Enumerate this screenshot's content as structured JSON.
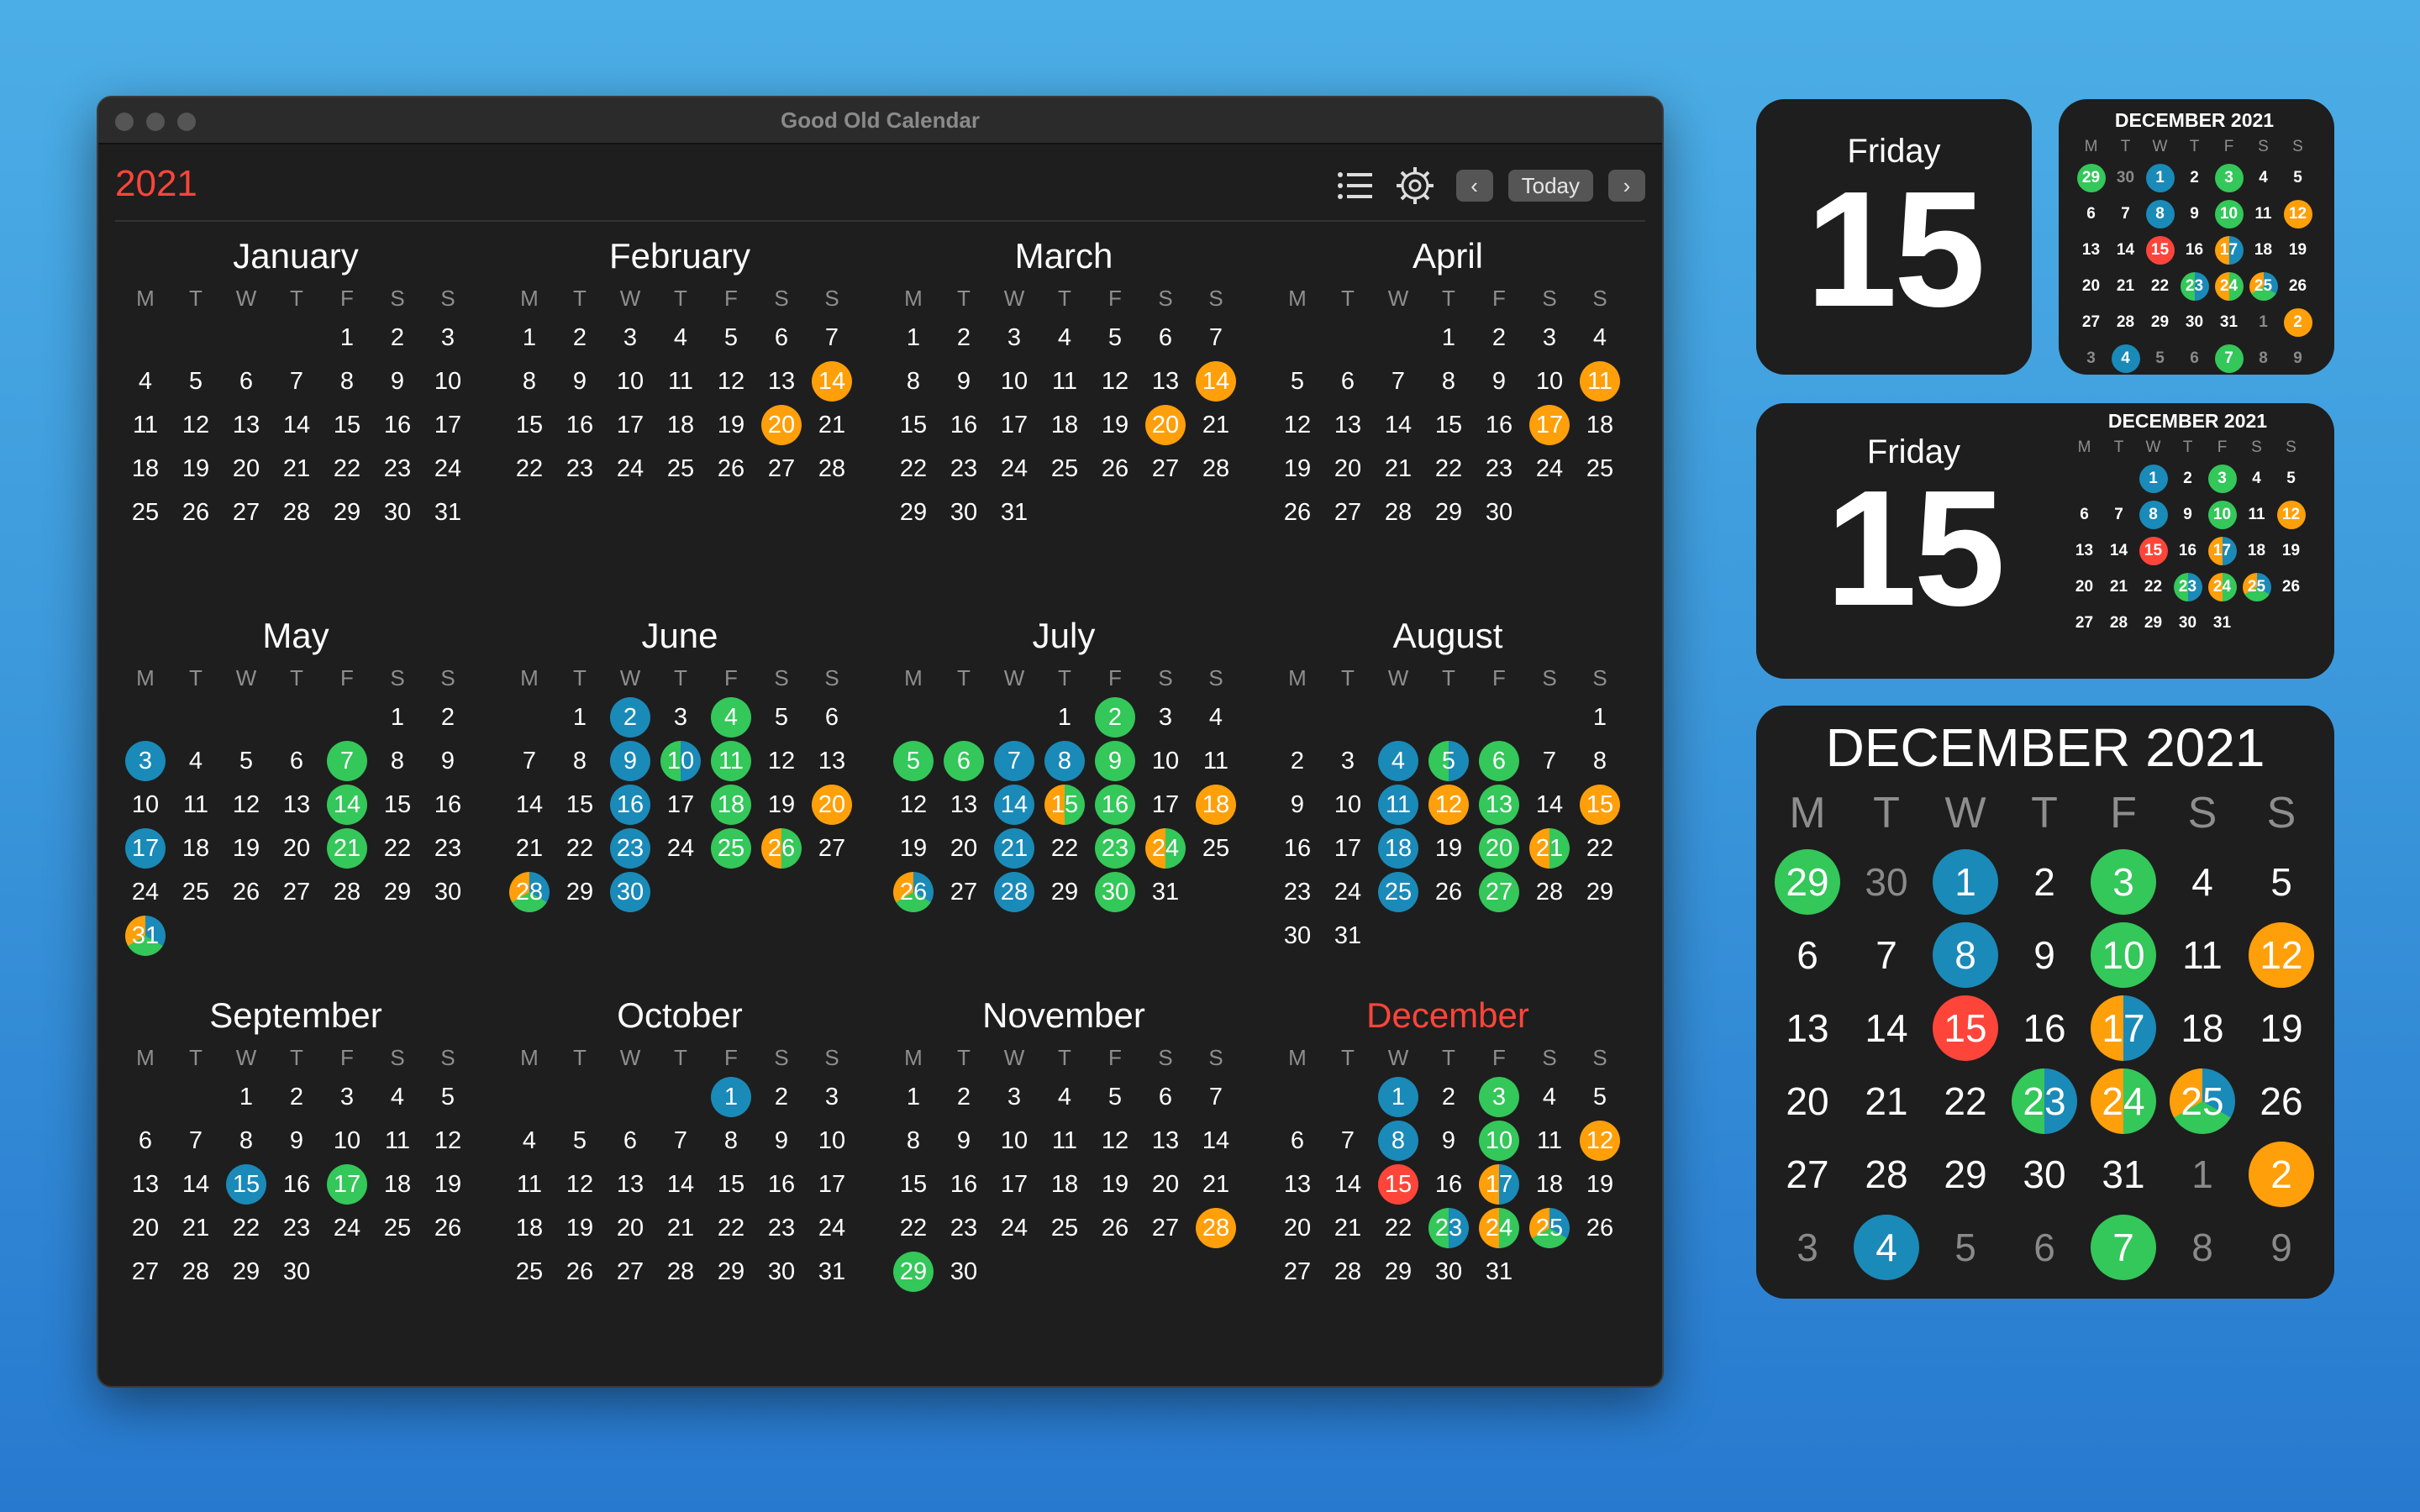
{
  "window": {
    "title": "Good Old Calendar"
  },
  "toolbar": {
    "year": "2021",
    "list_icon": "list-icon",
    "settings_icon": "gear-icon",
    "prev_label": "‹",
    "today_label": "Today",
    "next_label": "›"
  },
  "weekday_initials": [
    "M",
    "T",
    "W",
    "T",
    "F",
    "S",
    "S"
  ],
  "colors": {
    "green": "#34c759",
    "blue": "#1a8ab8",
    "orange": "#ff9f0a",
    "red": "#ff453a",
    "accent": "#ff453a"
  },
  "months": [
    {
      "name": "January",
      "offset": 4,
      "days": 31,
      "marks": {}
    },
    {
      "name": "February",
      "offset": 0,
      "days": 28,
      "marks": {
        "14": "o",
        "20": "o"
      }
    },
    {
      "name": "March",
      "offset": 0,
      "days": 31,
      "marks": {
        "14": "o",
        "20": "o"
      }
    },
    {
      "name": "April",
      "offset": 3,
      "days": 30,
      "marks": {
        "11": "o",
        "17": "o"
      }
    },
    {
      "name": "May",
      "offset": 5,
      "days": 31,
      "marks": {
        "3": "b",
        "7": "g",
        "14": "g",
        "17": "b",
        "21": "g",
        "31": "bgo"
      }
    },
    {
      "name": "June",
      "offset": 1,
      "days": 30,
      "marks": {
        "2": "b",
        "4": "g",
        "9": "b",
        "10": "bg",
        "11": "g",
        "16": "b",
        "18": "g",
        "20": "o",
        "23": "b",
        "25": "g",
        "26": "go",
        "28": "bgo",
        "30": "b"
      }
    },
    {
      "name": "July",
      "offset": 3,
      "days": 31,
      "marks": {
        "2": "g",
        "5": "g",
        "6": "g",
        "7": "b",
        "8": "b",
        "9": "g",
        "14": "b",
        "15": "go",
        "16": "g",
        "18": "o",
        "21": "b",
        "23": "g",
        "24": "go",
        "26": "bgo",
        "28": "b",
        "30": "g"
      }
    },
    {
      "name": "August",
      "offset": 6,
      "days": 31,
      "marks": {
        "4": "b",
        "5": "bg",
        "6": "g",
        "11": "b",
        "12": "o",
        "13": "g",
        "15": "o",
        "18": "b",
        "20": "g",
        "21": "go",
        "25": "b",
        "27": "g"
      }
    },
    {
      "name": "September",
      "offset": 2,
      "days": 30,
      "marks": {
        "15": "b",
        "17": "g"
      }
    },
    {
      "name": "October",
      "offset": 4,
      "days": 31,
      "marks": {
        "1": "b"
      }
    },
    {
      "name": "November",
      "offset": 0,
      "days": 30,
      "marks": {
        "28": "o",
        "29": "g"
      }
    },
    {
      "name": "December",
      "offset": 2,
      "days": 31,
      "current": true,
      "marks": {
        "1": "b",
        "3": "g",
        "8": "b",
        "10": "g",
        "12": "o",
        "15": "r",
        "17": "bo",
        "23": "bg",
        "24": "go",
        "25": "bgo"
      }
    }
  ],
  "widget_small": {
    "weekday": "Friday",
    "day": "15"
  },
  "widget_medium": {
    "weekday": "Friday",
    "day": "15"
  },
  "mini_month": {
    "title": "DECEMBER 2021",
    "weeks": [
      [
        [
          "29",
          "g"
        ],
        [
          "30",
          "d"
        ],
        [
          "1",
          "b"
        ],
        [
          "2",
          ""
        ],
        [
          "3",
          "g"
        ],
        [
          "4",
          ""
        ],
        [
          "5",
          ""
        ]
      ],
      [
        [
          "6",
          ""
        ],
        [
          "7",
          ""
        ],
        [
          "8",
          "b"
        ],
        [
          "9",
          ""
        ],
        [
          "10",
          "g"
        ],
        [
          "11",
          ""
        ],
        [
          "12",
          "o"
        ]
      ],
      [
        [
          "13",
          ""
        ],
        [
          "14",
          ""
        ],
        [
          "15",
          "r"
        ],
        [
          "16",
          ""
        ],
        [
          "17",
          "bo"
        ],
        [
          "18",
          ""
        ],
        [
          "19",
          ""
        ]
      ],
      [
        [
          "20",
          ""
        ],
        [
          "21",
          ""
        ],
        [
          "22",
          ""
        ],
        [
          "23",
          "bg"
        ],
        [
          "24",
          "go"
        ],
        [
          "25",
          "bgo"
        ],
        [
          "26",
          ""
        ]
      ],
      [
        [
          "27",
          ""
        ],
        [
          "28",
          ""
        ],
        [
          "29",
          ""
        ],
        [
          "30",
          ""
        ],
        [
          "31",
          ""
        ],
        [
          "1",
          "d"
        ],
        [
          "2",
          "o"
        ]
      ],
      [
        [
          "3",
          "d"
        ],
        [
          "4",
          "b"
        ],
        [
          "5",
          "d"
        ],
        [
          "6",
          "d"
        ],
        [
          "7",
          "g"
        ],
        [
          "8",
          "d"
        ],
        [
          "9",
          "d"
        ]
      ]
    ],
    "weeks_medium": [
      [
        [
          "",
          ""
        ],
        [
          "",
          ""
        ],
        [
          "1",
          "b"
        ],
        [
          "2",
          ""
        ],
        [
          "3",
          "g"
        ],
        [
          "4",
          ""
        ],
        [
          "5",
          ""
        ]
      ],
      [
        [
          "6",
          ""
        ],
        [
          "7",
          ""
        ],
        [
          "8",
          "b"
        ],
        [
          "9",
          ""
        ],
        [
          "10",
          "g"
        ],
        [
          "11",
          ""
        ],
        [
          "12",
          "o"
        ]
      ],
      [
        [
          "13",
          ""
        ],
        [
          "14",
          ""
        ],
        [
          "15",
          "r"
        ],
        [
          "16",
          ""
        ],
        [
          "17",
          "bo"
        ],
        [
          "18",
          ""
        ],
        [
          "19",
          ""
        ]
      ],
      [
        [
          "20",
          ""
        ],
        [
          "21",
          ""
        ],
        [
          "22",
          ""
        ],
        [
          "23",
          "bg"
        ],
        [
          "24",
          "go"
        ],
        [
          "25",
          "bgo"
        ],
        [
          "26",
          ""
        ]
      ],
      [
        [
          "27",
          ""
        ],
        [
          "28",
          ""
        ],
        [
          "29",
          ""
        ],
        [
          "30",
          ""
        ],
        [
          "31",
          ""
        ],
        [
          "",
          ""
        ],
        [
          "",
          ""
        ]
      ]
    ]
  },
  "large_widget": {
    "title": "DECEMBER 2021"
  }
}
